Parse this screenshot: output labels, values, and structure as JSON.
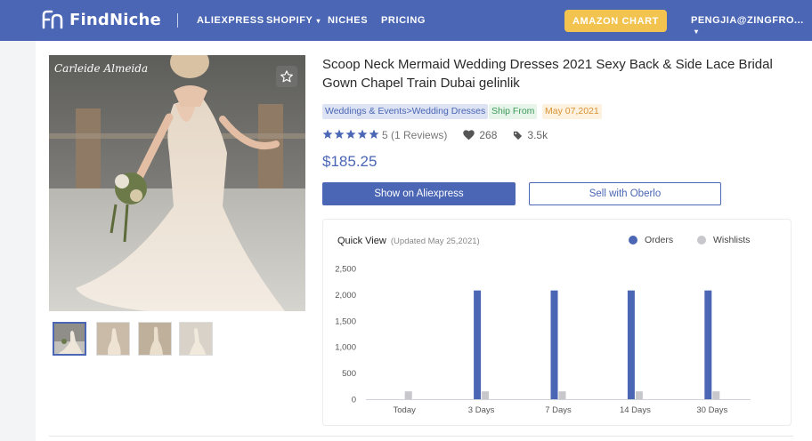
{
  "nav": {
    "logo": "FindNiche",
    "links": [
      {
        "label": "ALIEXPRESS"
      },
      {
        "label": "SHOPIFY",
        "caret": "▾"
      },
      {
        "label": "NICHES"
      },
      {
        "label": "PRICING"
      }
    ],
    "amazon_chart": "AMAZON CHART",
    "user": "PENGJIA@ZINGFRO...",
    "user_caret": "▾"
  },
  "product": {
    "photo_credit": "Carleide Almeida",
    "title": "Scoop Neck Mermaid Wedding Dresses 2021 Sexy Back & Side Lace Bridal Gown Chapel Train Dubai gelinlik",
    "tags": {
      "category": "Weddings & Events>Wedding Dresses",
      "ship_from": "Ship From",
      "date": "May 07,2021"
    },
    "rating": {
      "stars": 5,
      "text": "5 (1 Reviews)"
    },
    "likes": "268",
    "views": "3.5k",
    "price": "$185.25",
    "show_button": "Show on Aliexpress",
    "sell_button": "Sell with Oberlo",
    "thumb_count": 4
  },
  "quick_view": {
    "title": "Quick View",
    "subtitle": "(Updated May 25,2021)",
    "legend": [
      {
        "label": "Orders",
        "color": "#4a66b5"
      },
      {
        "label": "Wishlists",
        "color": "#c7c7cc"
      }
    ]
  },
  "chart_data": {
    "type": "bar",
    "categories": [
      "Today",
      "3 Days",
      "7 Days",
      "14 Days",
      "30 Days"
    ],
    "series": [
      {
        "name": "Orders",
        "color": "#4a66b5",
        "values": [
          0,
          2080,
          2080,
          2080,
          2080
        ]
      },
      {
        "name": "Wishlists",
        "color": "#c7c7cc",
        "values": [
          150,
          150,
          150,
          150,
          150
        ]
      }
    ],
    "yticks": [
      "0",
      "500",
      "1,000",
      "1,500",
      "2,000",
      "2,500"
    ],
    "ylim": [
      0,
      2500
    ],
    "grid": false,
    "legend_position": "top-right"
  }
}
